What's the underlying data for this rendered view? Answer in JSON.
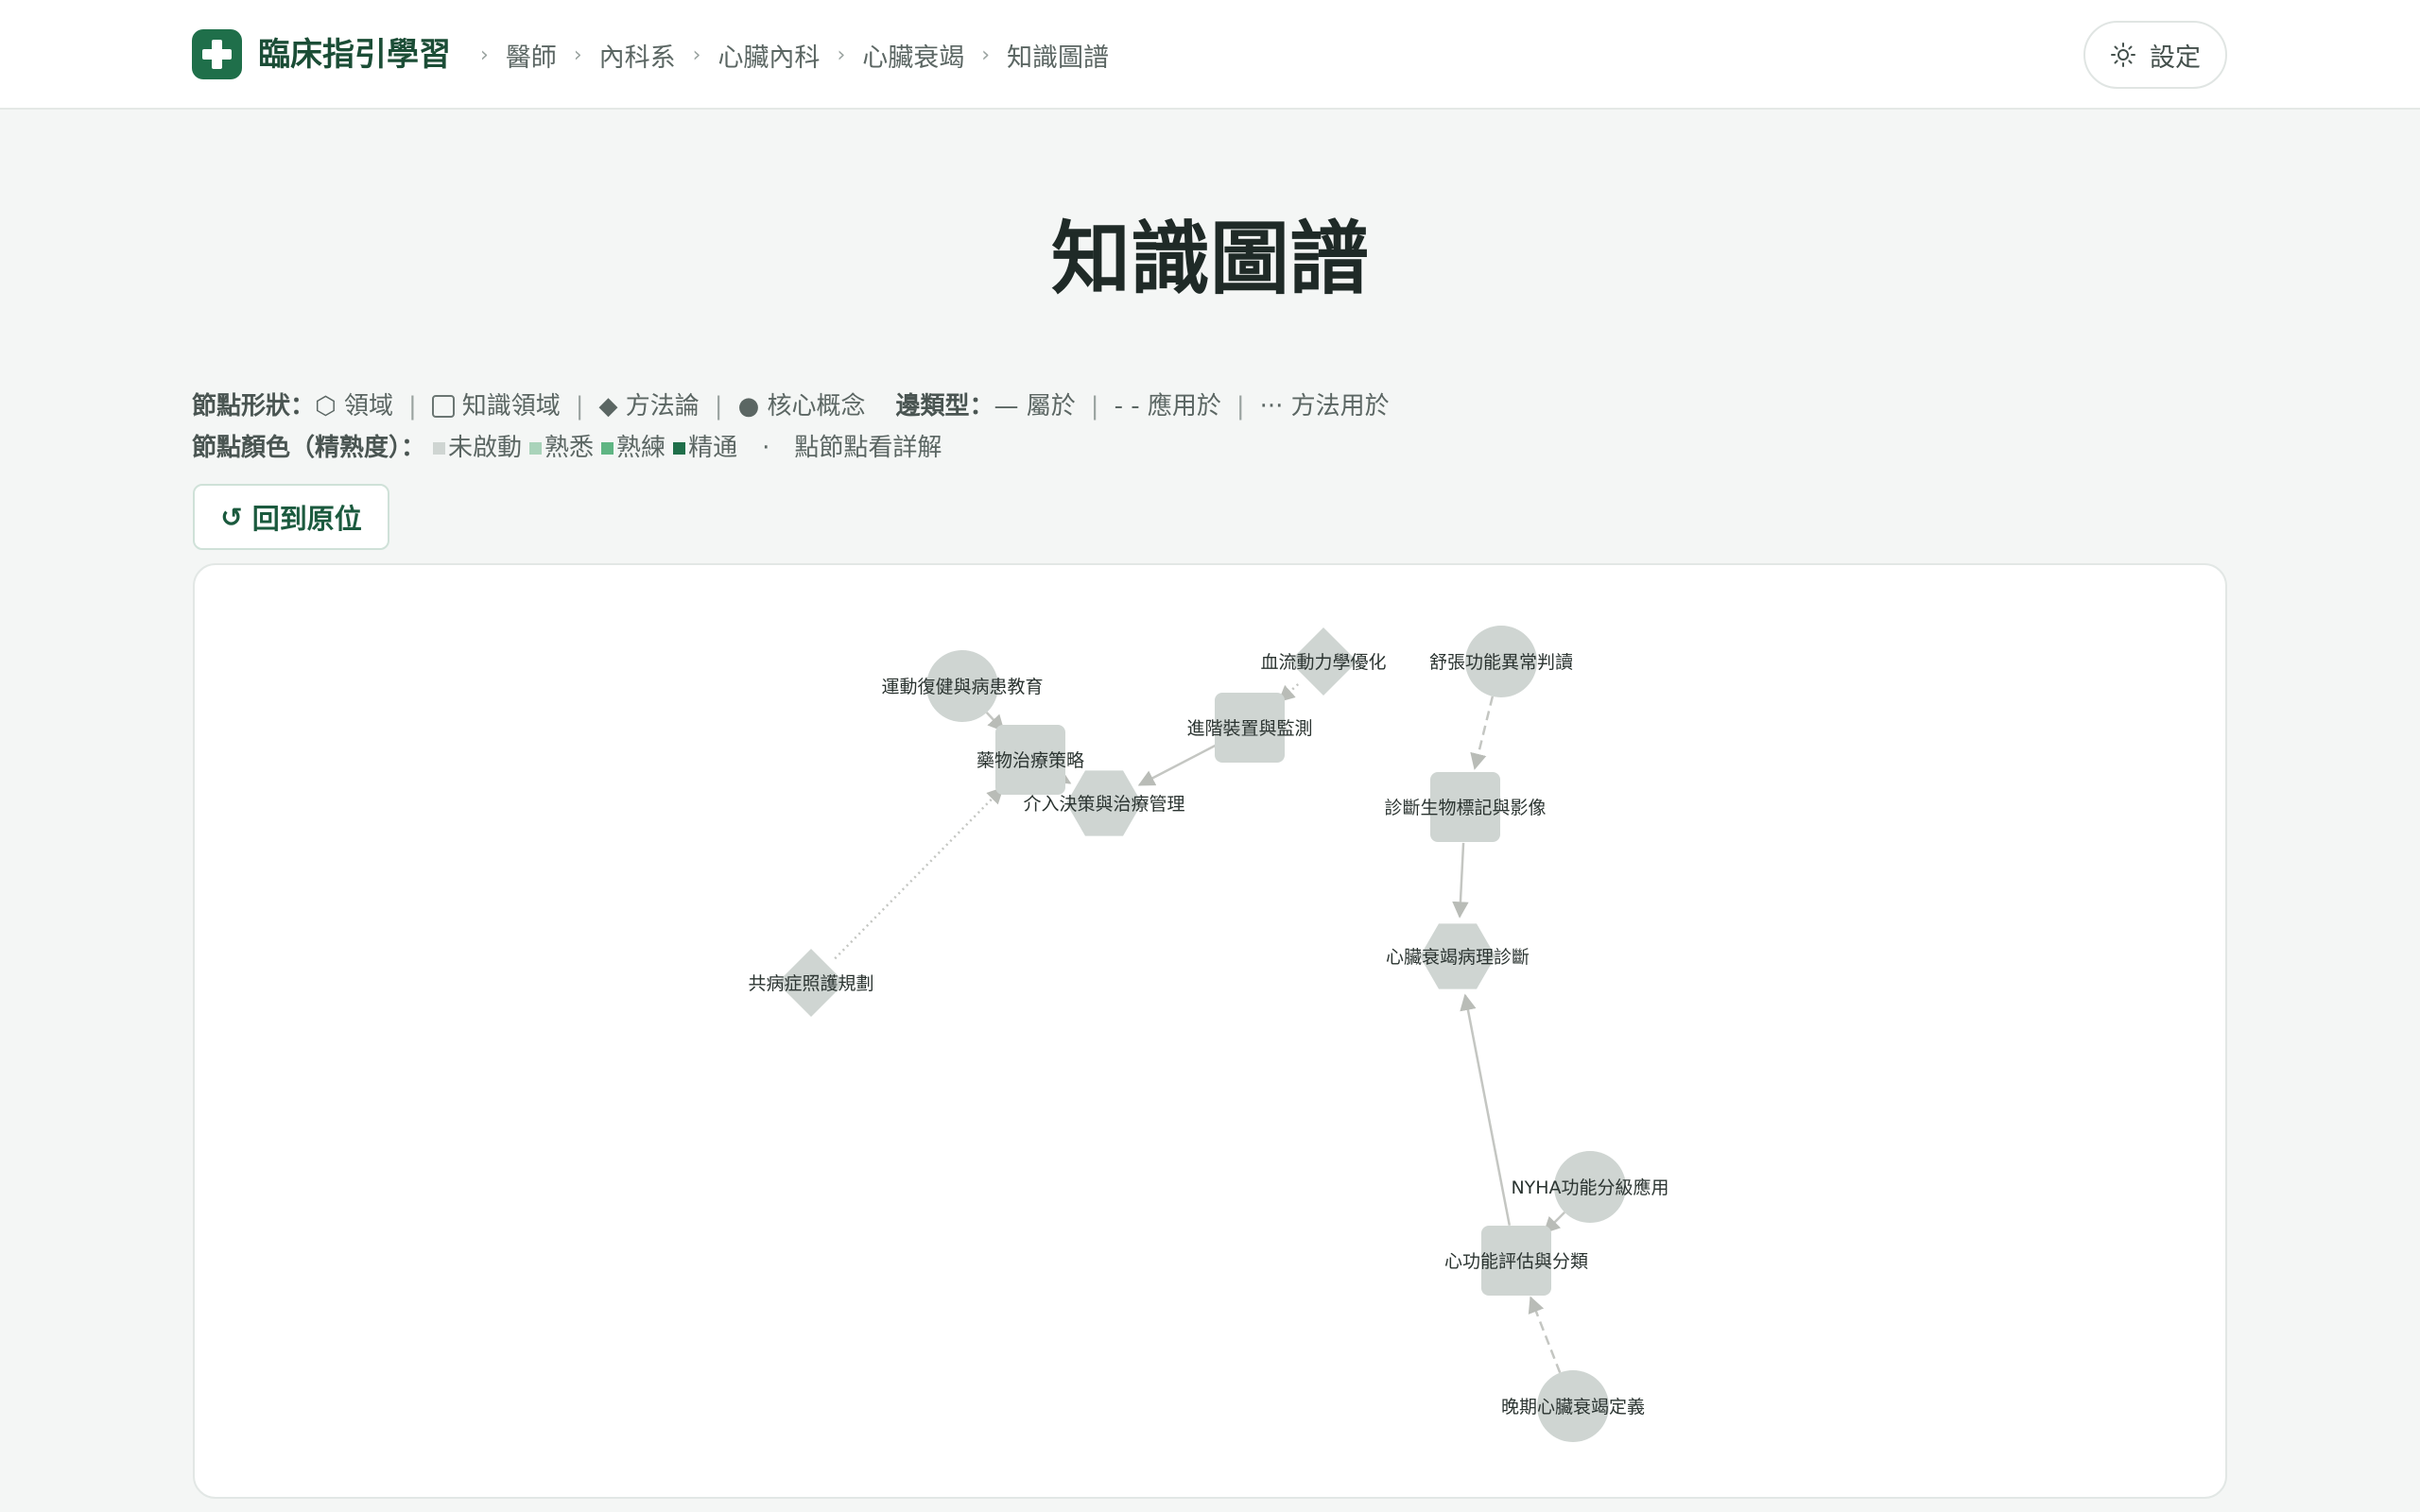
{
  "header": {
    "brand": "臨床指引學習",
    "breadcrumbs": [
      "醫師",
      "內科系",
      "心臟內科",
      "心臟衰竭",
      "知識圖譜"
    ],
    "settings_label": "設定"
  },
  "page": {
    "title": "知識圖譜"
  },
  "legend": {
    "shape_title": "節點形狀：",
    "shapes": [
      "⬡ 領域",
      "知識領域",
      "◆ 方法論",
      "● 核心概念"
    ],
    "edge_title": "邊類型：",
    "edges": [
      "— 屬於",
      "- - 應用於",
      "··· 方法用於"
    ],
    "color_title": "節點顏色（精熟度）：",
    "levels": [
      "未啟動",
      "熟悉",
      "熟練",
      "精通"
    ],
    "level_colors": [
      "#cfd5d2",
      "#a9d3ba",
      "#5fb583",
      "#1f6f4a"
    ],
    "bullet": "·",
    "hint": "點節點看詳解"
  },
  "controls": {
    "reset_label": "回到原位"
  },
  "colors": {
    "brand": "#1f6f4a",
    "node_unstarted": "#cfd5d2",
    "edge": "#c4c6c2"
  },
  "graph": {
    "nodes": [
      {
        "id": "n1",
        "label": "運動復健與病患教育",
        "type": "concept"
      },
      {
        "id": "n2",
        "label": "藥物治療策略",
        "type": "area"
      },
      {
        "id": "n3",
        "label": "介入決策與治療管理",
        "type": "domain"
      },
      {
        "id": "n4",
        "label": "進階裝置與監測",
        "type": "area"
      },
      {
        "id": "n5",
        "label": "血流動力學優化",
        "type": "method"
      },
      {
        "id": "n6",
        "label": "舒張功能異常判讀",
        "type": "concept"
      },
      {
        "id": "n7",
        "label": "診斷生物標記與影像",
        "type": "area"
      },
      {
        "id": "n8",
        "label": "心臟衰竭病理診斷",
        "type": "domain"
      },
      {
        "id": "n9",
        "label": "共病症照護規劃",
        "type": "method"
      },
      {
        "id": "n10",
        "label": "NYHA功能分級應用",
        "type": "concept"
      },
      {
        "id": "n11",
        "label": "心功能評估與分類",
        "type": "area"
      },
      {
        "id": "n12",
        "label": "晚期心臟衰竭定義",
        "type": "concept"
      }
    ],
    "edges": [
      {
        "from": "n1",
        "to": "n2",
        "type": "belongs"
      },
      {
        "from": "n2",
        "to": "n3",
        "type": "belongs"
      },
      {
        "from": "n4",
        "to": "n3",
        "type": "belongs"
      },
      {
        "from": "n5",
        "to": "n4",
        "type": "method"
      },
      {
        "from": "n9",
        "to": "n2",
        "type": "method"
      },
      {
        "from": "n6",
        "to": "n7",
        "type": "applies"
      },
      {
        "from": "n7",
        "to": "n8",
        "type": "belongs"
      },
      {
        "from": "n11",
        "to": "n8",
        "type": "belongs"
      },
      {
        "from": "n10",
        "to": "n11",
        "type": "belongs"
      },
      {
        "from": "n12",
        "to": "n11",
        "type": "applies"
      }
    ]
  }
}
